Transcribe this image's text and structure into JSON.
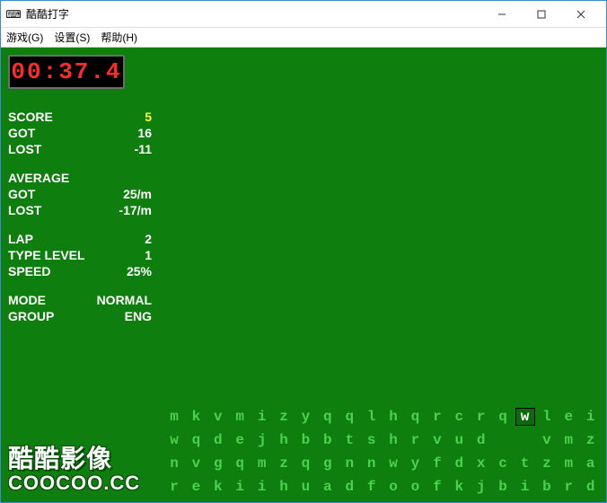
{
  "window": {
    "title": "酷酷打字",
    "icon_glyph": "⌨"
  },
  "menu": {
    "items": [
      "游戏(G)",
      "设置(S)",
      "帮助(H)"
    ]
  },
  "timer": "00:37.4",
  "stats": {
    "section1": [
      {
        "label": "SCORE",
        "value": "5",
        "highlight": true
      },
      {
        "label": "GOT",
        "value": "16"
      },
      {
        "label": "LOST",
        "value": "-11"
      }
    ],
    "section2_header": "AVERAGE",
    "section2": [
      {
        "label": "GOT",
        "value": "25/m"
      },
      {
        "label": "LOST",
        "value": "-17/m"
      }
    ],
    "section3": [
      {
        "label": "LAP",
        "value": "2"
      },
      {
        "label": "TYPE LEVEL",
        "value": "1"
      },
      {
        "label": "SPEED",
        "value": "25%"
      }
    ],
    "section4": [
      {
        "label": "MODE",
        "value": "NORMAL"
      },
      {
        "label": "GROUP",
        "value": "ENG"
      }
    ]
  },
  "logo": {
    "cn": "酷酷影像",
    "en": "COOCOO.CC"
  },
  "letters": {
    "rows": [
      [
        "m",
        "k",
        "v",
        "m",
        "i",
        "z",
        "y",
        "q",
        "q",
        "l",
        "h",
        "q",
        "r",
        "c",
        "r",
        "q",
        "w",
        "l",
        "e",
        "i"
      ],
      [
        "w",
        "q",
        "d",
        "e",
        "j",
        "h",
        "b",
        "b",
        "t",
        "s",
        "h",
        "r",
        "v",
        "u",
        "d",
        "",
        "",
        "v",
        "m",
        "z"
      ],
      [
        "n",
        "v",
        "g",
        "q",
        "m",
        "z",
        "q",
        "g",
        "n",
        "n",
        "w",
        "y",
        "f",
        "d",
        "x",
        "c",
        "t",
        "z",
        "m",
        "a"
      ],
      [
        "r",
        "e",
        "k",
        "i",
        "i",
        "h",
        "u",
        "a",
        "d",
        "f",
        "o",
        "o",
        "f",
        "k",
        "j",
        "b",
        "i",
        "b",
        "r",
        "d"
      ]
    ],
    "highlight": {
      "row": 0,
      "col": 16
    }
  }
}
